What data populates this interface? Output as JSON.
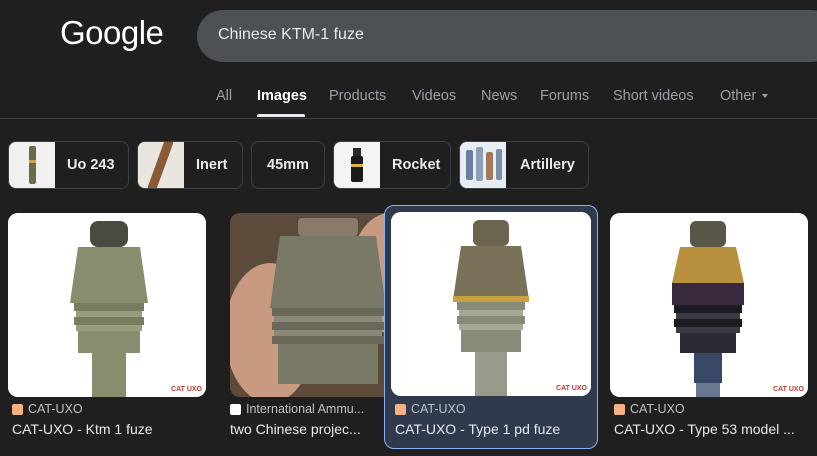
{
  "header": {
    "logo_text": "Google",
    "search_value": "Chinese KTM-1 fuze"
  },
  "tabs": [
    {
      "label": "All"
    },
    {
      "label": "Images"
    },
    {
      "label": "Products"
    },
    {
      "label": "Videos"
    },
    {
      "label": "News"
    },
    {
      "label": "Forums"
    },
    {
      "label": "Short videos"
    },
    {
      "label": "Other"
    }
  ],
  "chips": [
    {
      "label": "Uo 243",
      "icon": "shell-thumbnail"
    },
    {
      "label": "Inert",
      "icon": "rod-thumbnail"
    },
    {
      "label": "45mm",
      "icon": ""
    },
    {
      "label": "Rocket",
      "icon": "rocket-thumbnail"
    },
    {
      "label": "Artillery",
      "icon": "artillery-thumbnail"
    }
  ],
  "results": [
    {
      "source": "CAT-UXO",
      "title": "CAT-UXO - Ktm 1 fuze",
      "watermark": "CAT UXO"
    },
    {
      "source": "International Ammu...",
      "title": "two Chinese projec...",
      "watermark": ""
    },
    {
      "source": "CAT-UXO",
      "title": "CAT-UXO - Type 1 pd fuze",
      "watermark": "CAT UXO"
    },
    {
      "source": "CAT-UXO",
      "title": "CAT-UXO - Type 53 model ...",
      "watermark": "CAT UXO"
    }
  ],
  "colors": {
    "background": "#1f1f1f",
    "search_bg": "#4d5156",
    "selected_card_bg": "#303a4c",
    "selected_border": "#8ab4f8",
    "cat_uxo_favicon": "#f4b183"
  }
}
